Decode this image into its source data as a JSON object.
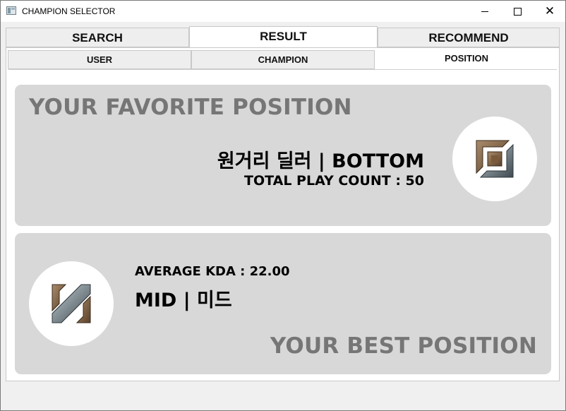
{
  "window": {
    "title": "CHAMPION SELECTOR"
  },
  "main_tabs": [
    {
      "label": "SEARCH",
      "active": false
    },
    {
      "label": "RESULT",
      "active": true
    },
    {
      "label": "RECOMMEND",
      "active": false
    }
  ],
  "sub_tabs": [
    {
      "label": "USER",
      "active": false
    },
    {
      "label": "CHAMPION",
      "active": false
    },
    {
      "label": "POSITION",
      "active": true
    }
  ],
  "favorite": {
    "heading": "YOUR FAVORITE POSITION",
    "position": "원거리 딜러 | BOTTOM",
    "play_count": "TOTAL PLAY COUNT : 50",
    "icon": "bottom-lane-icon"
  },
  "best": {
    "heading": "YOUR BEST POSITION",
    "kda": "AVERAGE KDA : 22.00",
    "position": "MID | 미드",
    "icon": "mid-lane-icon"
  },
  "colors": {
    "card_bg": "#d8d8d8",
    "heading_gray": "#767676",
    "icon_bronze": "#8b6a48",
    "icon_steel": "#5d6a70"
  }
}
